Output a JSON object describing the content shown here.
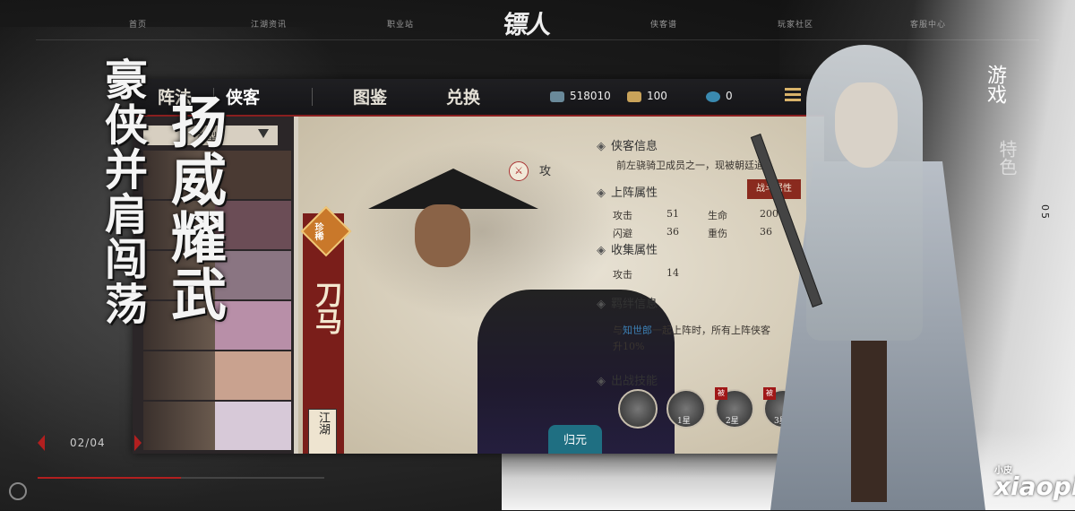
{
  "nav": {
    "items": [
      "首页",
      "江湖资讯",
      "职业站",
      "侠客谱",
      "玩家社区",
      "客服中心"
    ],
    "logo": "镖人"
  },
  "game": {
    "tabs": [
      "阵法",
      "侠客",
      "图鉴",
      "兑换"
    ],
    "resources": [
      {
        "icon": "gold-ingot-icon",
        "value": "518010",
        "color": "#6a8a9a"
      },
      {
        "icon": "silver-ingot-icon",
        "value": "100",
        "color": "#c9a35a"
      },
      {
        "icon": "token-icon",
        "value": "0",
        "color": "#3a8ab0"
      }
    ],
    "filter_label": "类型",
    "card": {
      "rarity": "珍稀",
      "name": "刀马",
      "sub": "江湖"
    },
    "attack_label": "攻",
    "info_title": "侠客信息",
    "info_desc": "前左骁骑卫成员之一，现被朝廷通",
    "battle_attr_title": "上阵属性",
    "battle_btn": "战斗属性",
    "stats": [
      {
        "label": "攻击",
        "value": "51"
      },
      {
        "label": "生命",
        "value": "200"
      },
      {
        "label": "闪避",
        "value": "36"
      },
      {
        "label": "重伤",
        "value": "36"
      }
    ],
    "collect_title": "收集属性",
    "collect_stat": {
      "label": "攻击",
      "value": "14"
    },
    "bond_title": "羁绊信息",
    "bond_text_1": "与",
    "bond_highlight": "知世郎",
    "bond_text_2": "一起上阵时，所有上阵侠客",
    "bond_text_3": "升10%",
    "skills_title": "出战技能",
    "skills": [
      {
        "level": ""
      },
      {
        "level": "1星",
        "badge": ""
      },
      {
        "level": "2星",
        "badge": "被"
      },
      {
        "level": "3星",
        "badge": "被"
      }
    ],
    "guiyuan": "归元"
  },
  "calligraphy": {
    "line_a": "豪侠并肩闯荡",
    "line_b": "扬威耀武"
  },
  "feature": {
    "title": "游戏",
    "subtitle": "特色",
    "page": "05"
  },
  "pager": {
    "current": "02/04",
    "progress": 0.5
  },
  "watermark": {
    "brand": "xiaopi",
    "small": "小皮"
  }
}
